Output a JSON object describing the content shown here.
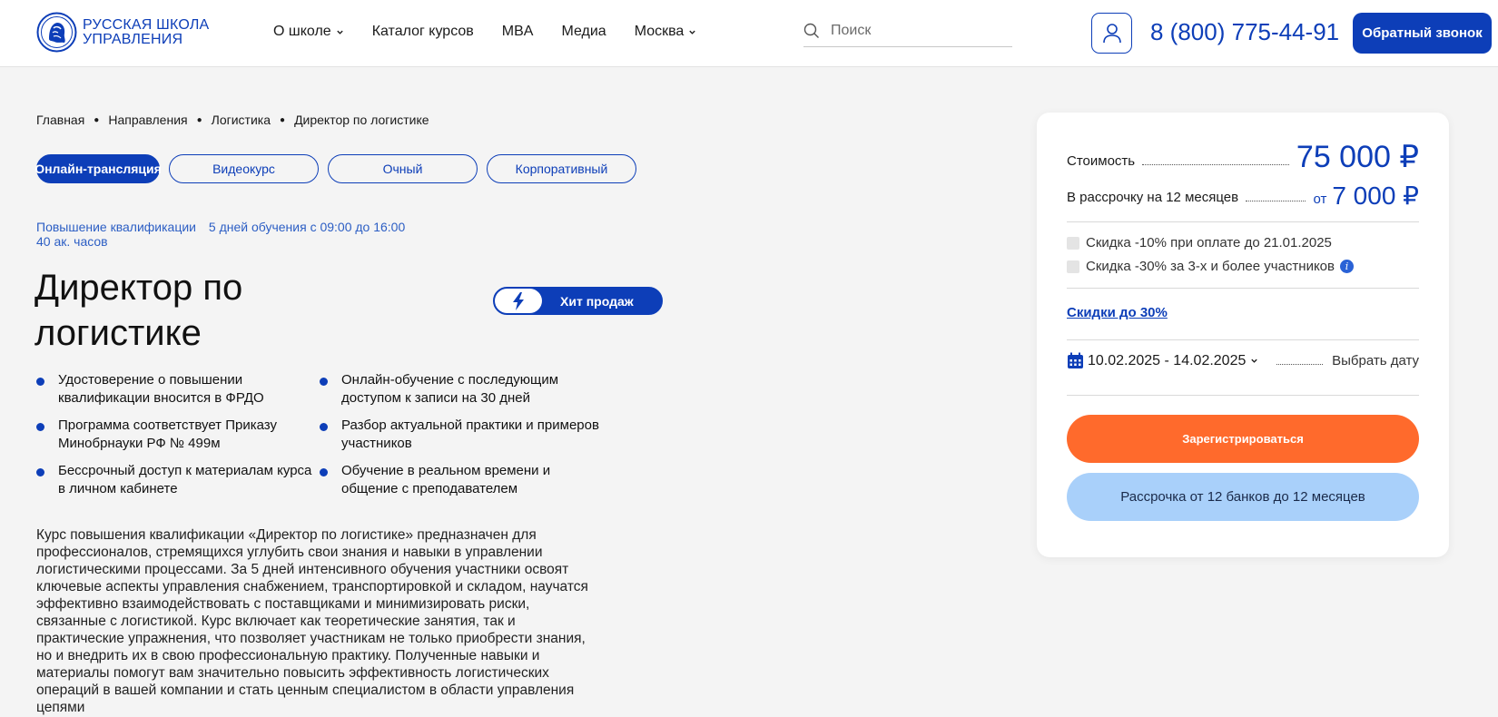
{
  "header": {
    "logo_line1": "РУССКАЯ ШКОЛА",
    "logo_line2": "УПРАВЛЕНИЯ",
    "nav": [
      {
        "label": "О школе",
        "has_dropdown": true
      },
      {
        "label": "Каталог курсов",
        "has_dropdown": false
      },
      {
        "label": "MBA",
        "has_dropdown": false
      },
      {
        "label": "Медиа",
        "has_dropdown": false
      },
      {
        "label": "Москва",
        "has_dropdown": true
      }
    ],
    "search_placeholder": "Поиск",
    "phone": "8 (800) 775-44-91",
    "callback_label": "Обратный звонок",
    "brand_color": "#0d3eb8"
  },
  "breadcrumb": [
    "Главная",
    "Направления",
    "Логистика",
    "Директор по логистике"
  ],
  "formats": [
    {
      "label": "Онлайн-трансляция",
      "active": true
    },
    {
      "label": "Видеокурс",
      "active": false
    },
    {
      "label": "Очный",
      "active": false
    },
    {
      "label": "Корпоративный",
      "active": false
    }
  ],
  "course": {
    "type": "Повышение квалификации",
    "schedule": "5 дней обучения с 09:00 до 16:00",
    "hours": "40 ак. часов",
    "title": "Директор по логистике",
    "badge": "Хит продаж",
    "features": [
      "Удостоверение о повышении квалификации вносится в ФРДО",
      "Онлайн-обучение с последующим доступом к записи на 30 дней",
      "Программа соответствует Приказу Минобрнауки РФ № 499м",
      "Разбор актуальной практики и примеров участников",
      "Бессрочный доступ к материалам курса в личном кабинете",
      "Обучение в реальном времени и общение с преподавателем"
    ],
    "description": "Курс повышения квалификации «Директор по логистике» предназначен для профессионалов, стремящихся углубить свои знания и навыки в управлении логистическими процессами. За 5 дней интенсивного обучения участники освоят ключевые аспекты управления снабжением, транспортировкой и складом, научатся эффективно взаимодействовать с поставщиками и минимизировать риски, связанные с логистикой. Курс включает как теоретические занятия, так и практические упражнения, что позволяет участникам не только приобрести знания, но и внедрить их в свою профессиональную практику. Полученные навыки и материалы помогут вам значительно повысить эффективность логистических операций в вашей компании и стать ценным специалистом в области управления цепями"
  },
  "pricing": {
    "cost_label": "Стоимость",
    "cost_value": "75 000 ₽",
    "installment_label": "В рассрочку на 12 месяцев",
    "installment_from": "от",
    "installment_value": "7 000 ₽",
    "discount1": "Скидка -10% при оплате до 21.01.2025",
    "discount2": "Скидка -30% за 3-х и более участников",
    "discounts_link": "Скидки до 30%",
    "date_range": "10.02.2025 - 14.02.2025",
    "pick_date": "Выбрать дату",
    "register_label": "Зарегистрироваться",
    "installment_button": "Рассрочка от 12 банков до 12 месяцев",
    "accent_orange": "#ff6a2c",
    "accent_light_blue": "#a9d0fa"
  }
}
